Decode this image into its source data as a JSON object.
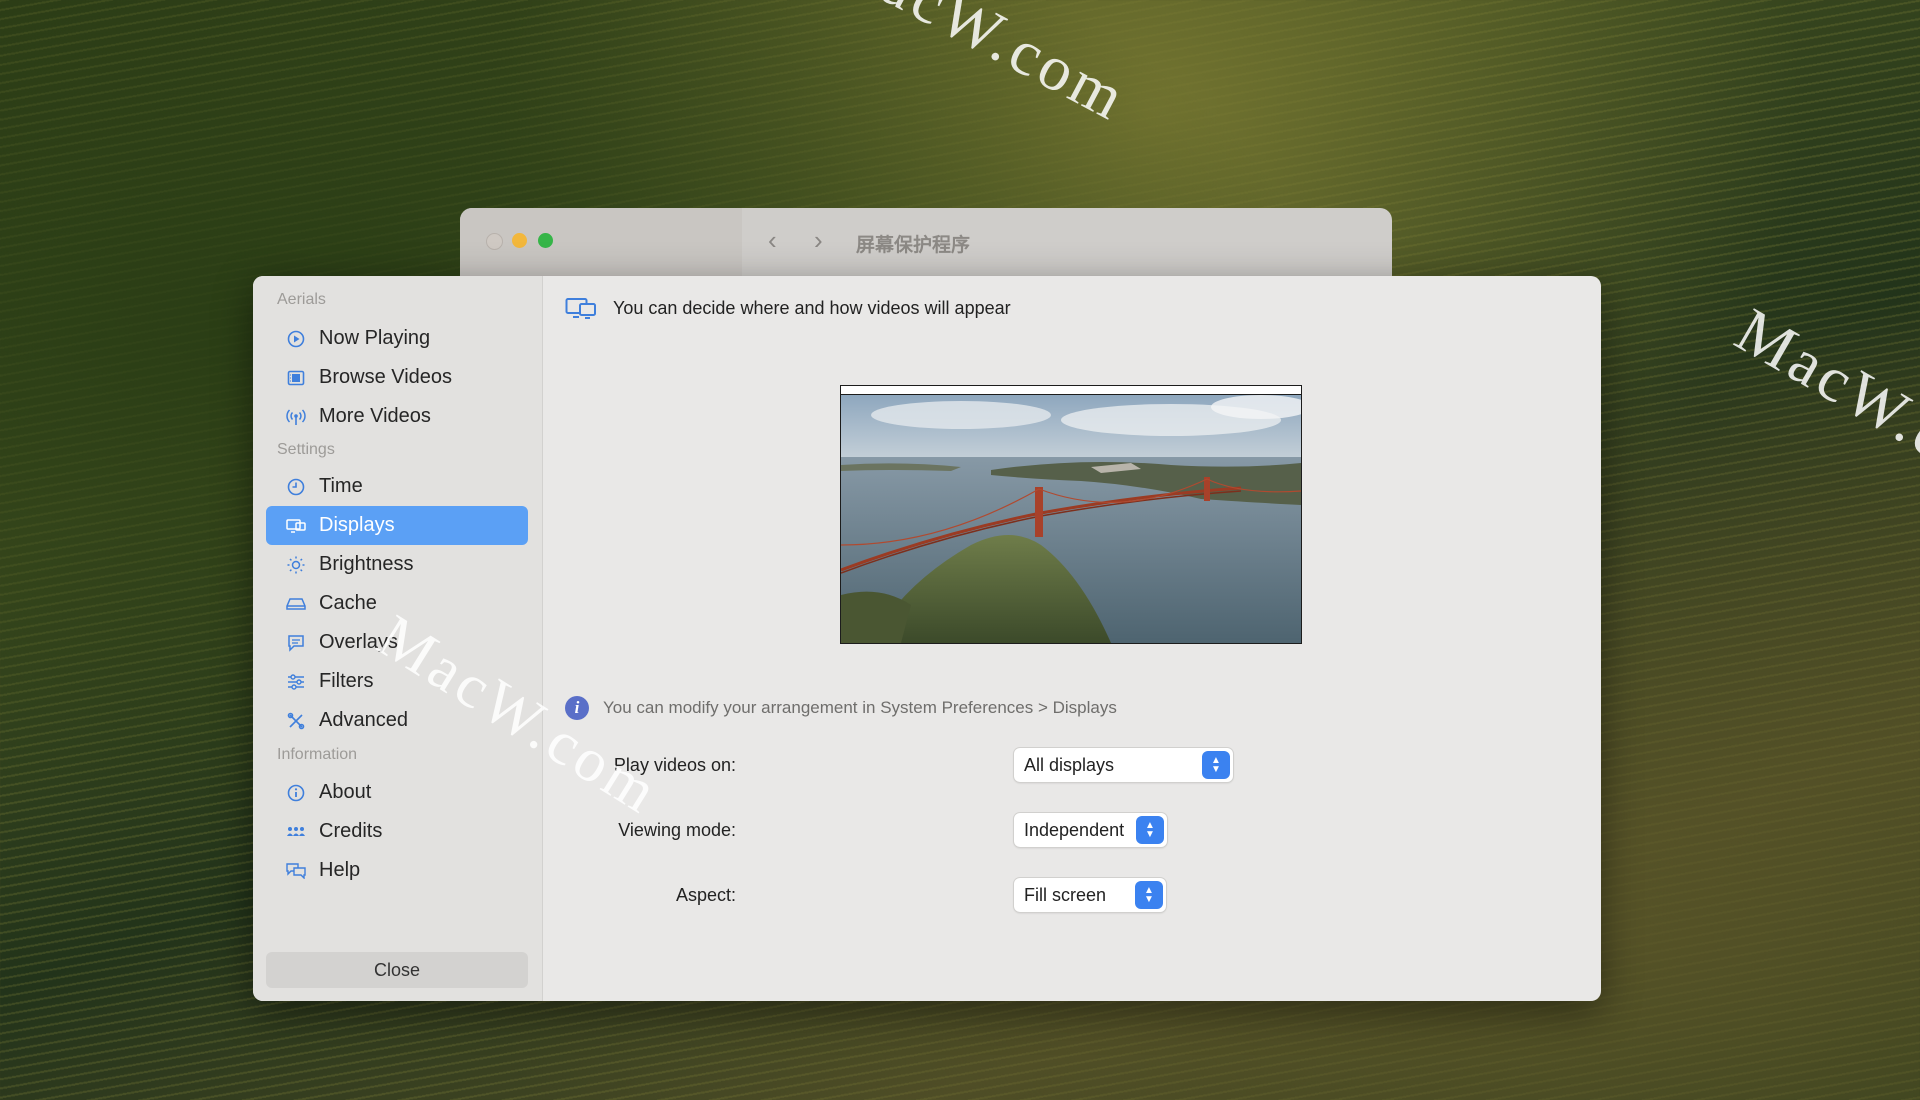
{
  "watermark": "MacW.com",
  "background_window": {
    "title": "屏幕保护程序",
    "back_glyph": "‹",
    "forward_glyph": "›"
  },
  "sidebar": {
    "sections": [
      {
        "header": "Aerials",
        "items": [
          {
            "label": "Now Playing",
            "icon": "play-circle-icon"
          },
          {
            "label": "Browse Videos",
            "icon": "film-icon"
          },
          {
            "label": "More Videos",
            "icon": "broadcast-icon"
          }
        ]
      },
      {
        "header": "Settings",
        "items": [
          {
            "label": "Time",
            "icon": "clock-icon"
          },
          {
            "label": "Displays",
            "icon": "displays-icon",
            "active": true
          },
          {
            "label": "Brightness",
            "icon": "sun-icon"
          },
          {
            "label": "Cache",
            "icon": "drive-icon"
          },
          {
            "label": "Overlays",
            "icon": "speech-bubble-icon"
          },
          {
            "label": "Filters",
            "icon": "sliders-icon"
          },
          {
            "label": "Advanced",
            "icon": "tools-icon"
          }
        ]
      },
      {
        "header": "Information",
        "items": [
          {
            "label": "About",
            "icon": "info-circle-icon"
          },
          {
            "label": "Credits",
            "icon": "people-icon"
          },
          {
            "label": "Help",
            "icon": "chat-bubbles-icon"
          }
        ]
      }
    ],
    "close_label": "Close"
  },
  "content": {
    "headline": "You can decide where and how videos will appear",
    "info_text": "You can modify your arrangement in System Preferences > Displays",
    "info_glyph": "i",
    "fields": {
      "play_on": {
        "label": "Play videos on:",
        "value": "All displays"
      },
      "viewing_mode": {
        "label": "Viewing mode:",
        "value": "Independent"
      },
      "aspect": {
        "label": "Aspect:",
        "value": "Fill screen"
      }
    }
  },
  "colors": {
    "accent": "#3b82f0",
    "sidebar_active": "#5ba0f5",
    "icon_blue": "#3f7fdc"
  }
}
